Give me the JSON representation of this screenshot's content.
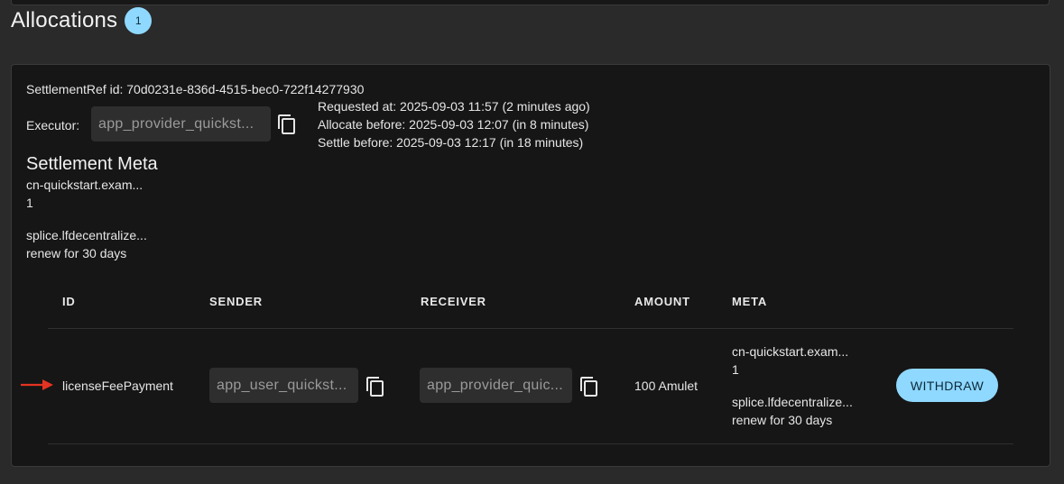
{
  "header": {
    "title": "Allocations",
    "count": "1"
  },
  "settlement": {
    "ref_id": "SettlementRef id: 70d0231e-836d-4515-bec0-722f14277930",
    "executor_label": "Executor:",
    "executor_value": "app_provider_quickst...",
    "requested_at": "Requested at: 2025-09-03 11:57 (2 minutes ago)",
    "allocate_before": "Allocate before: 2025-09-03 12:07 (in 8 minutes)",
    "settle_before": "Settle before: 2025-09-03 12:17 (in 18 minutes)"
  },
  "meta": {
    "title": "Settlement Meta",
    "key1": "cn-quickstart.exam...",
    "val1": "1",
    "key2": "splice.lfdecentralize...",
    "val2": "renew for 30 days"
  },
  "table": {
    "columns": [
      "ID",
      "SENDER",
      "RECEIVER",
      "AMOUNT",
      "META"
    ],
    "rows": [
      {
        "id": "licenseFeePayment",
        "sender": "app_user_quickst...",
        "receiver": "app_provider_quic...",
        "amount": "100 Amulet",
        "meta_key1": "cn-quickstart.exam...",
        "meta_val1": "1",
        "meta_key2": "splice.lfdecentralize...",
        "meta_val2": "renew for 30 days",
        "action": "WITHDRAW"
      }
    ]
  },
  "icons": {
    "copy": "copy-icon",
    "arrow": "arrow-right-icon"
  },
  "colors": {
    "accent": "#8fd8ff",
    "arrow": "#e53322",
    "background": "#2a2a2a",
    "card": "#161616"
  }
}
